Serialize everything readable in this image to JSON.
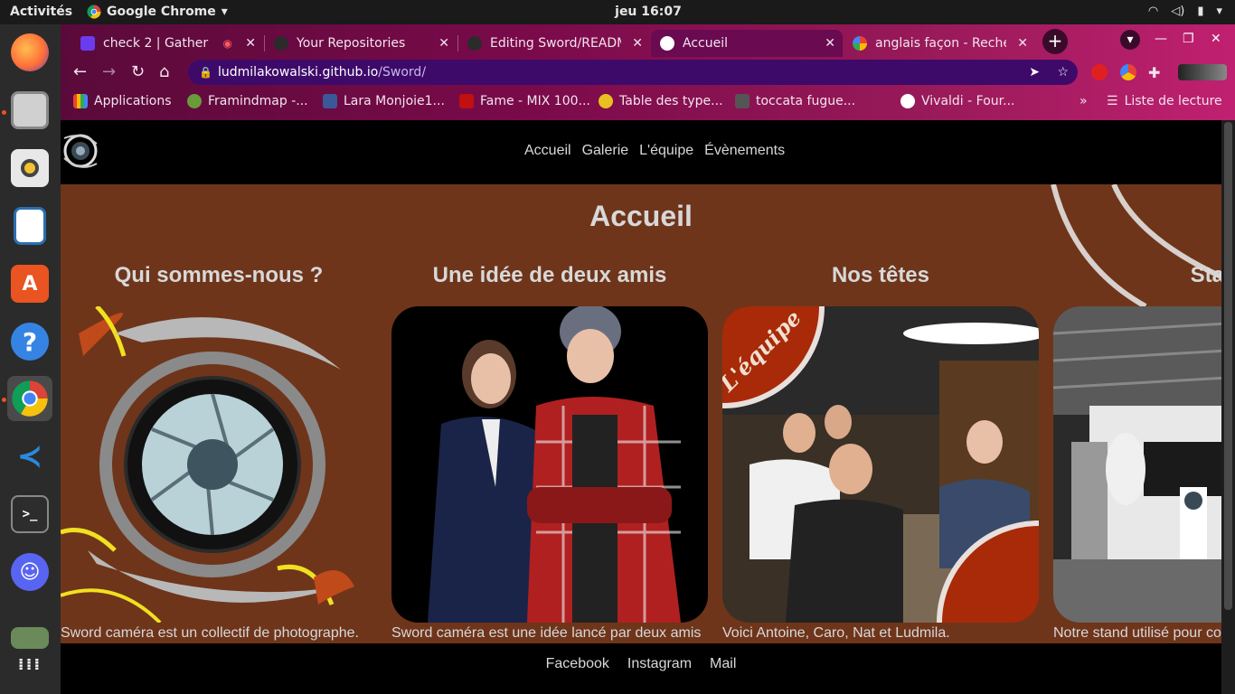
{
  "system": {
    "activities": "Activités",
    "app_name": "Google Chrome",
    "clock": "jeu 16:07"
  },
  "dock": {
    "items": [
      "firefox-icon",
      "files-icon",
      "rhythmbox-icon",
      "writer-icon",
      "software-icon",
      "help-icon",
      "chrome-icon",
      "vscode-icon",
      "terminal-icon",
      "discord-icon",
      "image-viewer-icon",
      "app-grid-icon"
    ]
  },
  "browser": {
    "tabs": [
      {
        "title": "check 2 | Gather"
      },
      {
        "title": "Your Repositories"
      },
      {
        "title": "Editing Sword/READM"
      },
      {
        "title": "Accueil"
      },
      {
        "title": "anglais façon - Recher"
      }
    ],
    "url_host": "ludmilakowalski.github.io",
    "url_path": "/Sword/",
    "bookmarks": [
      {
        "label": "Applications"
      },
      {
        "label": "Framindmap -..."
      },
      {
        "label": "Lara Monjoie1..."
      },
      {
        "label": "Fame - MIX 100..."
      },
      {
        "label": "Table des type..."
      },
      {
        "label": "toccata fugue..."
      },
      {
        "label": "Vivaldi - Four..."
      }
    ],
    "reading_list": "Liste de lecture",
    "overflow": "»"
  },
  "site": {
    "nav": [
      "Accueil",
      "Galerie",
      "L'équipe",
      "Évènements"
    ],
    "title": "Accueil",
    "cards": [
      {
        "heading": "Qui sommes-nous ?",
        "caption": "Sword caméra est un collectif de photographe."
      },
      {
        "heading": "Une idée de deux amis",
        "caption": "Sword caméra est une idée lancé par deux amis"
      },
      {
        "heading": "Nos têtes",
        "caption": "Voici Antoine, Caro, Nat et Ludmila.",
        "badge": "L'équipe"
      },
      {
        "heading": "Star",
        "caption": "Notre stand utilisé pour co"
      }
    ],
    "footer": [
      "Facebook",
      "Instagram",
      "Mail"
    ]
  }
}
